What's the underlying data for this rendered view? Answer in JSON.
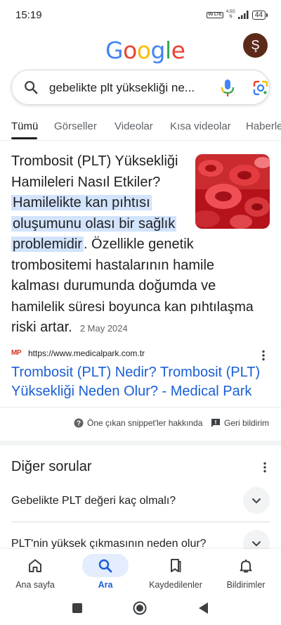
{
  "status": {
    "time": "15:19",
    "network": "4.5G",
    "volte": "Vo LTE",
    "battery": "44"
  },
  "header": {
    "logo": "Google",
    "avatar_initial": "Ş"
  },
  "search": {
    "query": "gebelikte plt yüksekliği ne..."
  },
  "tabs": [
    {
      "label": "Tümü",
      "active": true
    },
    {
      "label": "Görseller",
      "active": false
    },
    {
      "label": "Videolar",
      "active": false
    },
    {
      "label": "Kısa videolar",
      "active": false
    },
    {
      "label": "Haberle",
      "active": false
    }
  ],
  "snippet": {
    "intro_line1": "Trombosit (PLT) Yüksekliği",
    "intro_line2": "Hamileleri Nasıl Etkiler?",
    "hl_line1": "Hamilelikte kan pıhtısı",
    "hl_line2": "oluşumunu olası bir sağlık",
    "hl_line3": "problemidir",
    "rest_line1_suffix": ". Özellikle genetik",
    "rest_line2": "trombositemi hastalarının hamile",
    "rest_line3": "kalması durumunda doğumda ve",
    "rest_line4": "hamilelik süresi boyunca kan pıhtılaşma",
    "rest_line5": "riski artar.",
    "date": "2 May 2024"
  },
  "source": {
    "favicon_text": "MP",
    "url": "https://www.medicalpark.com.tr",
    "title": "Trombosit (PLT) Nedir? Trombosit (PLT) Yüksekliği Neden Olur? - Medical Park"
  },
  "feedback": {
    "about_label": "Öne çıkan snippet'ler hakkında",
    "feedback_label": "Geri bildirim"
  },
  "paa": {
    "title": "Diğer sorular",
    "questions": [
      "Gebelikte PLT değeri kaç olmalı?",
      "PLT'nin yüksek çıkmasının neden olur?"
    ]
  },
  "bottom_nav": [
    {
      "label": "Ana sayfa",
      "icon": "home-icon",
      "active": false
    },
    {
      "label": "Ara",
      "icon": "search-icon",
      "active": true
    },
    {
      "label": "Kaydedilenler",
      "icon": "bookmark-icon",
      "active": false
    },
    {
      "label": "Bildirimler",
      "icon": "bell-icon",
      "active": false
    }
  ],
  "colors": {
    "link": "#1a5fd6",
    "highlight": "#d2e3fc",
    "active_nav_pill": "#e3edfd",
    "avatar_bg": "#5d2a1a"
  }
}
